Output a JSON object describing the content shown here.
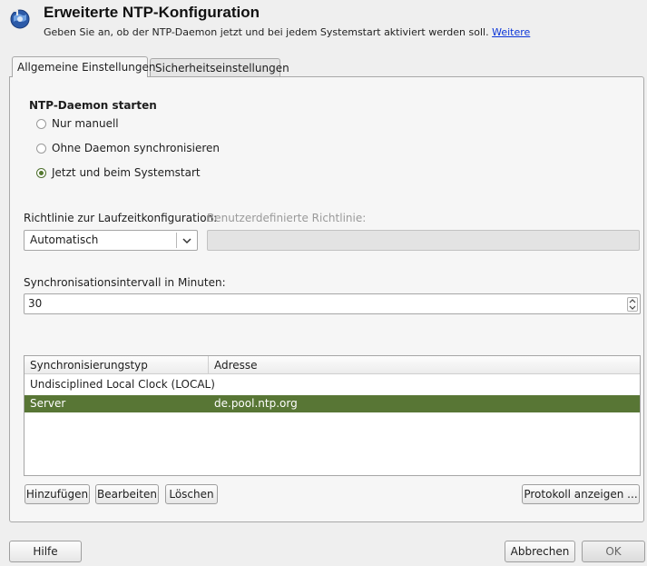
{
  "header": {
    "title": "Erweiterte NTP-Konfiguration",
    "subtitle": "Geben Sie an, ob der NTP-Daemon jetzt und bei jedem Systemstart aktiviert werden soll.",
    "more_link": "Weitere"
  },
  "tabs": [
    {
      "label": "Allgemeine Einstellungen",
      "active": true
    },
    {
      "label": "Sicherheitseinstellungen",
      "active": false
    }
  ],
  "daemon": {
    "heading": "NTP-Daemon starten",
    "options": [
      {
        "label": "Nur manuell",
        "selected": false
      },
      {
        "label": "Ohne Daemon synchronisieren",
        "selected": false
      },
      {
        "label": "Jetzt und beim Systemstart",
        "selected": true
      }
    ]
  },
  "policy": {
    "label": "Richtlinie zur Laufzeitkonfiguration:",
    "value": "Automatisch",
    "custom_label": "Benutzerdefinierte Richtlinie:",
    "custom_value": ""
  },
  "interval": {
    "label": "Synchronisationsintervall in Minuten:",
    "value": "30"
  },
  "servers": {
    "columns": [
      "Synchronisierungstyp",
      "Adresse"
    ],
    "rows": [
      {
        "type": "Undisciplined Local Clock (LOCAL)",
        "address": "",
        "selected": false
      },
      {
        "type": "Server",
        "address": "de.pool.ntp.org",
        "selected": true
      }
    ]
  },
  "actions": {
    "add": "Hinzufügen",
    "edit": "Bearbeiten",
    "delete": "Löschen",
    "log": "Protokoll anzeigen ..."
  },
  "footer": {
    "help": "Hilfe",
    "cancel": "Abbrechen",
    "ok": "OK"
  },
  "colors": {
    "accent": "#587635",
    "link": "#0b35d8"
  },
  "icons": {
    "header": "yast-ntp-icon",
    "combo": "chevron-down-icon",
    "spin": "spin-updown-icon"
  }
}
